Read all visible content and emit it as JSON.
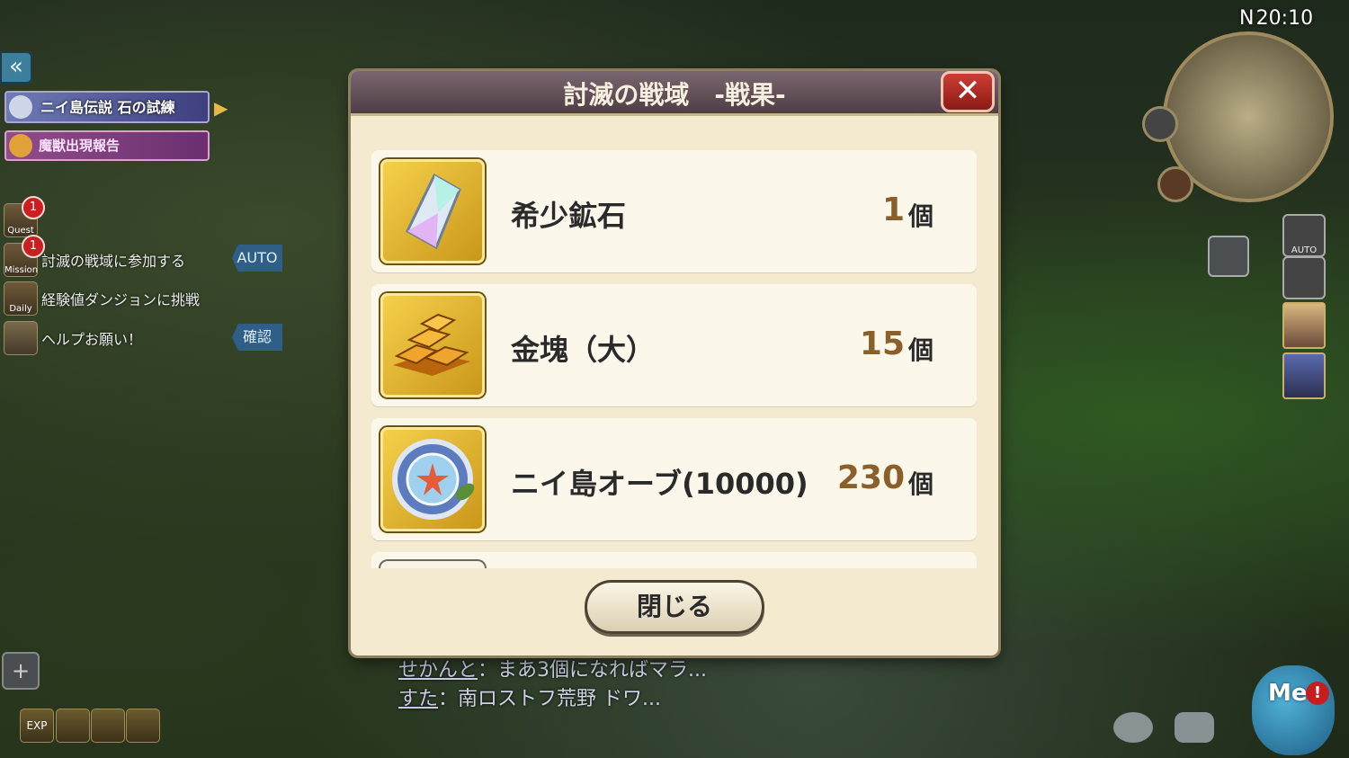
{
  "hud": {
    "clock": "20:10",
    "compass": "N",
    "auto_label": "AUTO",
    "me_label": "Me"
  },
  "left_panel": {
    "banner_main": "ニイ島伝説 石の試練",
    "banner_sub": "魔獣出現報告",
    "quests": [
      {
        "icon_label": "Quest",
        "badge": "1",
        "text": "討滅の戦域に参加する",
        "tag": "AUTO"
      },
      {
        "icon_label": "Mission",
        "badge": "1",
        "text": "経験値ダンジョンに挑戦",
        "tag": ""
      },
      {
        "icon_label": "Daily",
        "badge": "",
        "text": "ヘルプお願い！",
        "tag": "確認"
      }
    ],
    "bottom_icons": [
      "EXP",
      "",
      "",
      ""
    ]
  },
  "chat": [
    {
      "name": "せかんと",
      "message": "：まあ3個になればマラ..."
    },
    {
      "name": "すた",
      "message": "：南ロストフ荒野 ドワ..."
    }
  ],
  "dialog": {
    "title": "討滅の戦域　-戦果-",
    "close_label": "✕",
    "ok_label": "閉じる",
    "items": [
      {
        "name": "希少鉱石",
        "qty": "1",
        "unit": "個",
        "icon": "crystal-icon"
      },
      {
        "name": "金塊（大）",
        "qty": "15",
        "unit": "個",
        "icon": "gold-bars-icon"
      },
      {
        "name": "ニイ島オーブ(10000)",
        "qty": "230",
        "unit": "個",
        "icon": "orb-icon"
      }
    ]
  },
  "colors": {
    "header": "#5f4d55",
    "panel": "#f3ead0",
    "qty": "#8a5f2a",
    "close": "#b52a22"
  }
}
